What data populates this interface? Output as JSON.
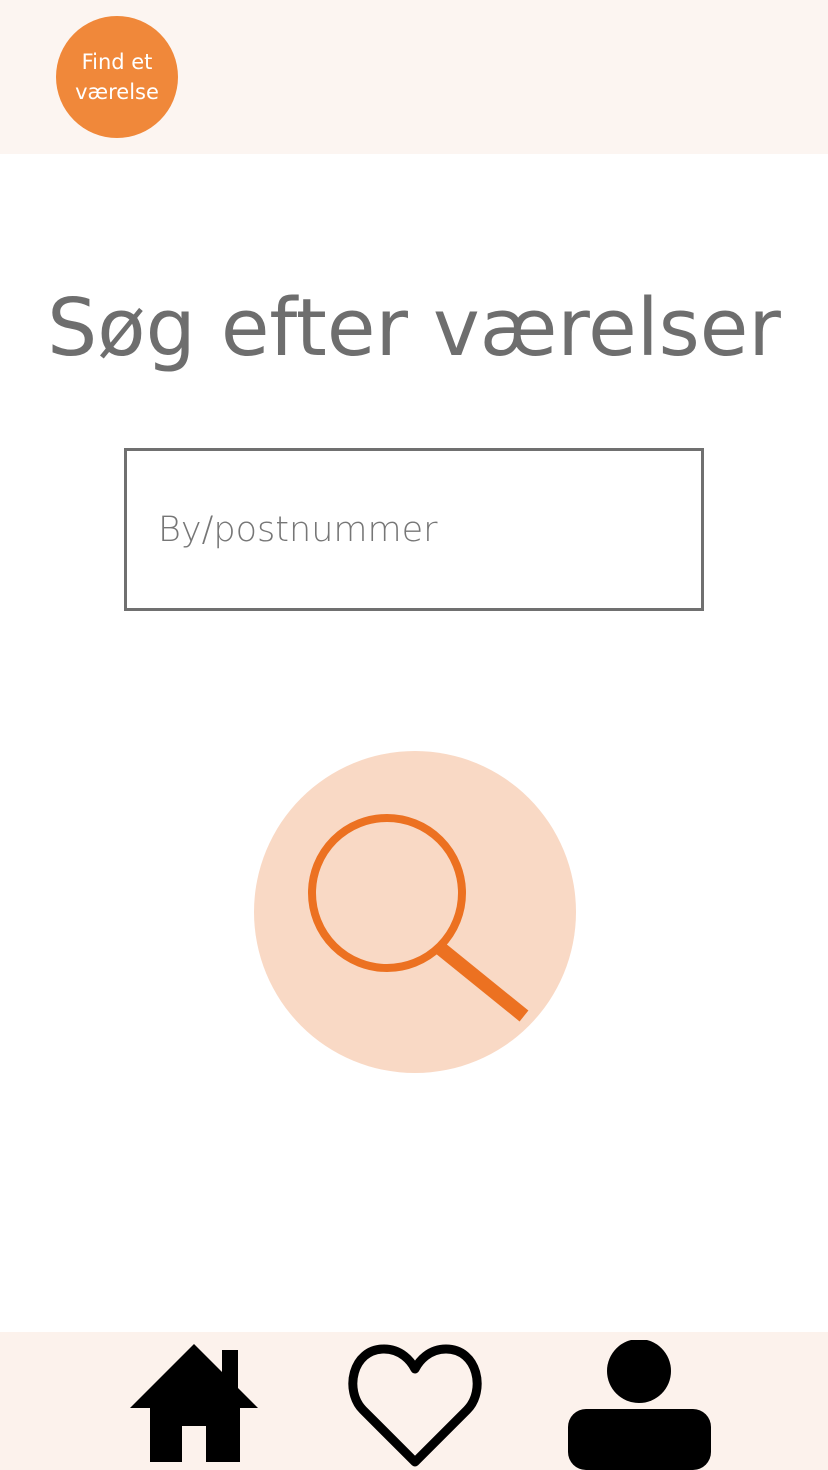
{
  "app": {
    "logo_text": "Find et værelse"
  },
  "main": {
    "title": "Søg efter værelser",
    "search": {
      "value": "",
      "placeholder": "By/postnummer"
    }
  },
  "bottom_nav": {
    "items": [
      {
        "icon": "home-icon"
      },
      {
        "icon": "heart-icon"
      },
      {
        "icon": "user-icon"
      }
    ]
  },
  "colors": {
    "accent": "#f0883a",
    "accent_dark": "#ec7121",
    "accent_light": "#f9d9c5",
    "bar_background": "#fcf5f1",
    "text_gray": "#6e6e6e"
  }
}
